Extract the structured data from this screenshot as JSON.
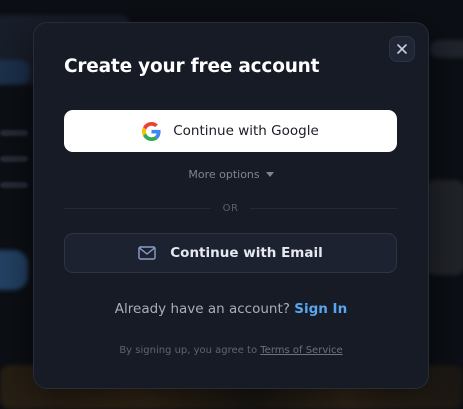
{
  "modal": {
    "title": "Create your free account",
    "close_icon": "close-icon",
    "google_button": {
      "label": "Continue with Google",
      "icon": "google-logo-icon"
    },
    "more_options": {
      "label": "More options",
      "icon": "caret-down-icon"
    },
    "divider_text": "OR",
    "email_button": {
      "label": "Continue with Email",
      "icon": "envelope-icon"
    },
    "signin": {
      "prompt": "Already have an account?",
      "link": "Sign In"
    },
    "terms": {
      "prefix": "By signing up, you agree to",
      "link": "Terms of Service"
    }
  },
  "colors": {
    "modal_bg": "#161b26",
    "link_blue": "#5aa4f0",
    "google_button_bg": "#ffffff"
  }
}
